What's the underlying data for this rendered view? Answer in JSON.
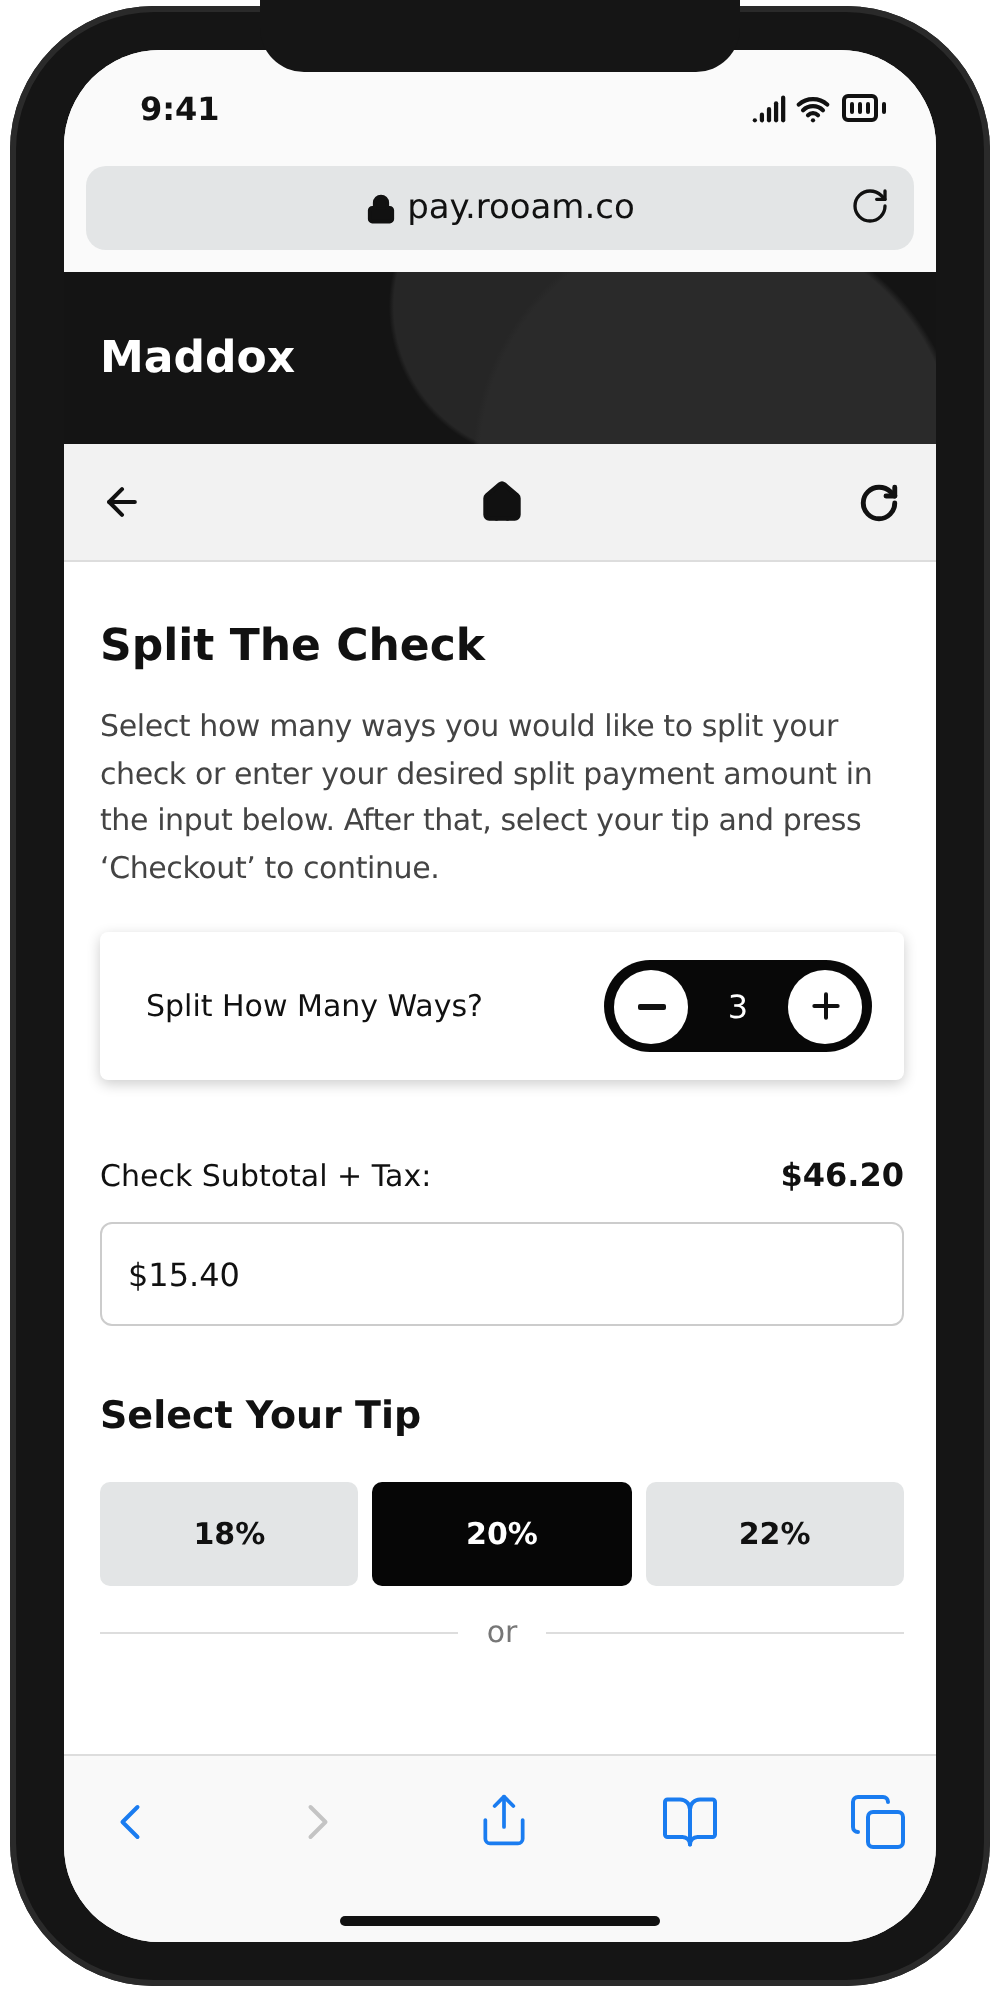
{
  "status_bar": {
    "time": "9:41"
  },
  "browser": {
    "url": "pay.rooam.co"
  },
  "header": {
    "title": "Maddox"
  },
  "page": {
    "title": "Split The Check",
    "intro": "Select how many ways you would like to split your check or enter your desired split payment amount in the input below. After that, select your tip and press ‘Checkout’ to continue.",
    "split": {
      "label": "Split How Many Ways?",
      "count": "3"
    },
    "subtotal": {
      "label": "Check Subtotal + Tax:",
      "amount": "$46.20"
    },
    "amount_field": {
      "value": "$15.40"
    },
    "tip_title": "Select Your Tip",
    "tips": [
      {
        "label": "18%",
        "selected": false
      },
      {
        "label": "20%",
        "selected": true
      },
      {
        "label": "22%",
        "selected": false
      }
    ],
    "divider": "or"
  },
  "toolbar": {
    "back": {
      "disabled": false
    },
    "forward": {
      "disabled": true
    }
  }
}
